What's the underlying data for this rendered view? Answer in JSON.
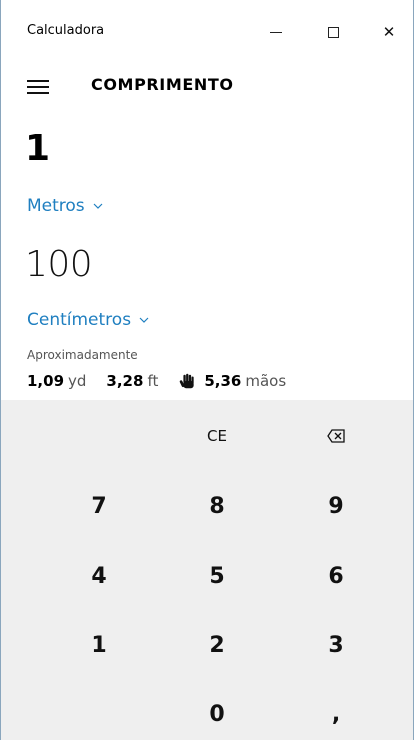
{
  "window": {
    "title": "Calculadora",
    "close_glyph": "✕"
  },
  "header": {
    "mode_title": "COMPRIMENTO",
    "menu_icon": "hamburger-icon"
  },
  "converter": {
    "from_value": "1",
    "from_unit": "Metros",
    "to_value": "100",
    "to_unit": "Centímetros"
  },
  "approximately": {
    "label": "Aproximadamente",
    "items": [
      {
        "value": "1,09",
        "unit": "yd"
      },
      {
        "value": "3,28",
        "unit": "ft"
      },
      {
        "value": "5,36",
        "unit": "mãos",
        "icon": "hand-icon"
      }
    ]
  },
  "keypad": {
    "ce": "CE",
    "backspace_icon": "backspace-icon",
    "keys": [
      "7",
      "8",
      "9",
      "4",
      "5",
      "6",
      "1",
      "2",
      "3",
      "0",
      ","
    ]
  },
  "colors": {
    "accent": "#1f7fc0",
    "keypad_bg": "#efefef"
  }
}
